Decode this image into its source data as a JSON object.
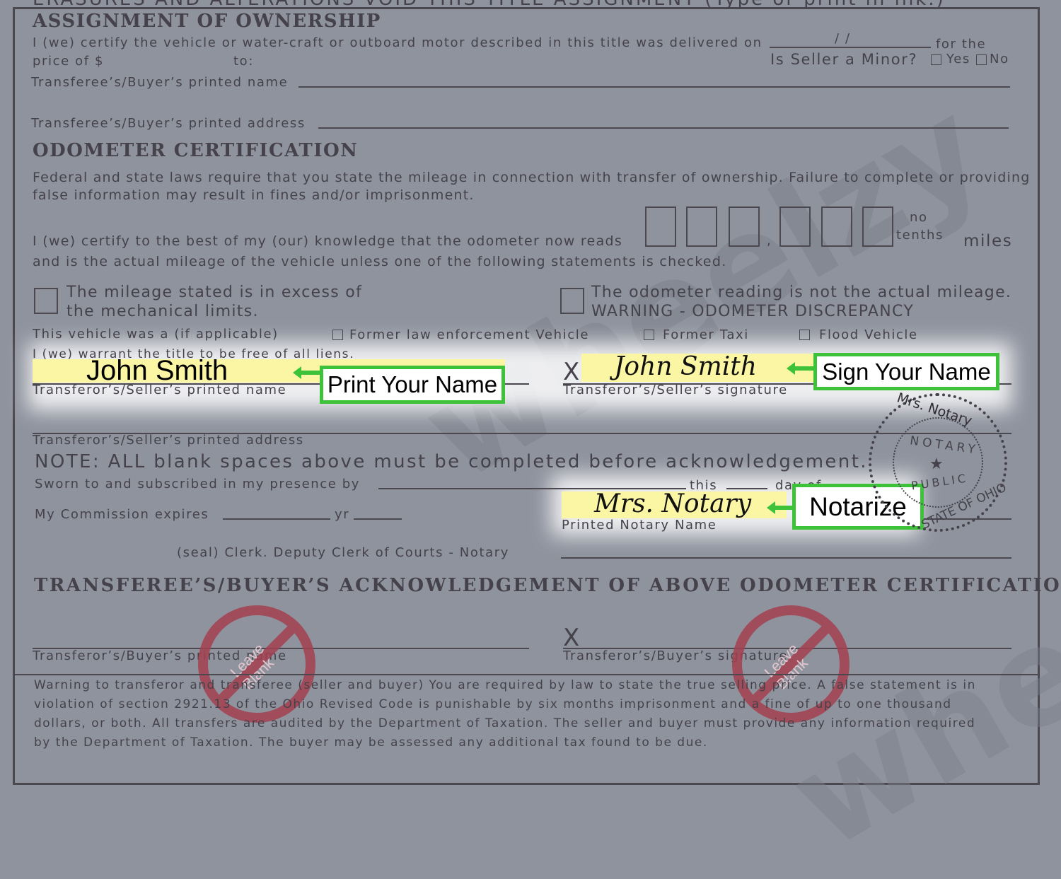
{
  "header_cut": "ERASURES AND ALTERATIONS VOID THIS TITLE ASSIGNMENT (Type or print in ink.)",
  "assignment": {
    "heading": "ASSIGNMENT OF OWNERSHIP",
    "line1": "I (we) certify the vehicle or water-craft or outboard motor described in this title was delivered on",
    "date_sep": "/          /",
    "for_the": "for the",
    "price": "price of $",
    "to": "to:",
    "minor_q": "Is Seller a Minor?",
    "yes": "Yes",
    "no": "No",
    "buyer_name": "Transferee’s/Buyer’s  printed name",
    "buyer_address": "Transferee’s/Buyer’s printed address"
  },
  "odometer": {
    "heading": "ODOMETER CERTIFICATION",
    "p1": "Federal and state laws require that you state the mileage in connection with transfer of ownership. Failure to complete or providing",
    "p2": "false information may result in fines and/or imprisonment.",
    "certify1": "I (we) certify to the best of my (our) knowledge that the odometer now reads",
    "certify2": "and is the actual mileage of the vehicle unless one of the following statements is checked.",
    "comma": ",",
    "no_tenths_1": "no",
    "no_tenths_2": "tenths",
    "miles": "miles",
    "excess_1": "The mileage stated is in excess of",
    "excess_2": "the mechanical limits.",
    "notactual_1": "The odometer reading is not the actual mileage.",
    "notactual_2": "WARNING - ODOMETER DISCREPANCY",
    "vehicle_was": "This vehicle was a (if applicable)",
    "opt1": "Former law enforcement Vehicle",
    "opt2": "Former Taxi",
    "opt3": "Flood Vehicle",
    "warrant": "I (we) warrant the title to be free of all liens."
  },
  "seller": {
    "name_value": "John Smith",
    "name_label": "Transferor’s/Seller’s printed name",
    "print_callout": "Print Your Name",
    "x": "X",
    "signature_value": "John Smith",
    "signature_label": "Transferor’s/Seller’s signature",
    "sign_callout": "Sign Your Name",
    "address_label": "Transferor’s/Seller’s printed address"
  },
  "notary": {
    "note": "NOTE: ALL blank spaces above must be completed before acknowledgement.",
    "sworn": "Sworn to and subscribed in my presence by",
    "this": "this",
    "day_of": "day of",
    "commission": "My Commission expires",
    "yr": "yr",
    "name_value": "Mrs. Notary",
    "name_label": "Printed Notary Name",
    "callout": "Notarize",
    "seal_line": "(seal) Clerk. Deputy Clerk of Courts - Notary",
    "seal": {
      "name": "Mrs. Notary",
      "top": "NOTARY",
      "bottom": "PUBLIC",
      "state": "STATE OF OHIO"
    }
  },
  "buyer_ack": {
    "heading": "TRANSFEREE’S/BUYER’S ACKNOWLEDGEMENT OF ABOVE ODOMETER CERTIFICATION",
    "x": "X",
    "name_label": "Transferor’s/Buyer’s printed name",
    "signature_label": "Transferor’s/Buyer’s signature",
    "leave_blank": "Leave Blank"
  },
  "warning": [
    "Warning to transferor and transferee (seller and buyer) You are required by law to state the true selling price. A false statement is in",
    "violation of section 2921.13 of the Ohio Revised Code is punishable by six months  imprisonment  and a fine of up to one thousand",
    "dollars, or both. All transfers are audited by the Department of Taxation. The seller and buyer must provide any information required",
    "by the Department of Taxation. The buyer may be assessed any additional tax found to be due."
  ],
  "watermark": "wheelzy",
  "colors": {
    "callout_border": "#3dc23a",
    "highlight": "#fbf6a4",
    "leave_blank": "#a3404f"
  }
}
